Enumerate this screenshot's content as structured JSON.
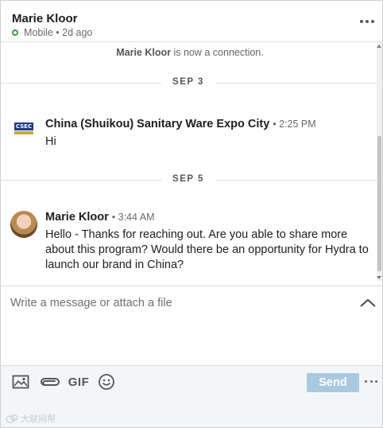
{
  "header": {
    "name": "Marie Kloor",
    "status": "Mobile • 2d ago",
    "more_icon": "more-horizontal-icon"
  },
  "thread": {
    "connection_note": {
      "name": "Marie Kloor",
      "text": " is now a connection."
    },
    "groups": [
      {
        "date": "SEP 3",
        "sender": "China (Shuikou) Sanitary Ware Expo City",
        "time": "• 2:25 PM",
        "body": "Hi",
        "logo_text": "CSEC"
      },
      {
        "date": "SEP 5",
        "sender": "Marie Kloor",
        "time": "• 3:44 AM",
        "body": "Hello - Thanks for reaching out. Are you able to share more about this program? Would there be an opportunity for Hydra to launch our brand in China?"
      }
    ]
  },
  "compose": {
    "placeholder": "Write a message or attach a file",
    "value": ""
  },
  "toolbar": {
    "gif_label": "GIF",
    "send_label": "Send"
  },
  "watermark": {
    "text": "大联网帮"
  },
  "colors": {
    "send_disabled": "#a9c9e1",
    "presence": "#3a9b3a",
    "background": "#f3f6f8"
  }
}
